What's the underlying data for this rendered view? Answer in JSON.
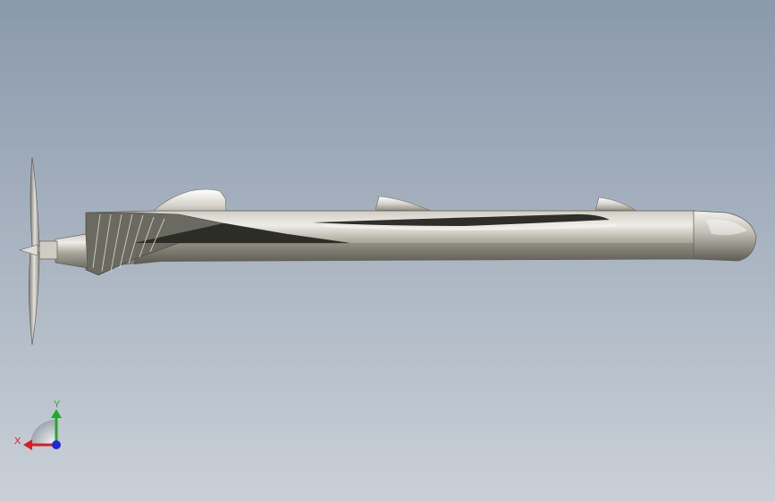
{
  "viewport": {
    "background_top": "#8a99ac",
    "background_bottom": "#c9d0d7"
  },
  "model": {
    "body_color": "#a6a497",
    "shadow_color": "#56554c",
    "highlight_color": "#e6e4dc",
    "propeller_color": "#b5b3aa"
  },
  "triad": {
    "x_label": "X",
    "y_label": "Y",
    "x_color": "#d61f1f",
    "y_color": "#1faa2a",
    "z_color": "#1f2ad6"
  }
}
